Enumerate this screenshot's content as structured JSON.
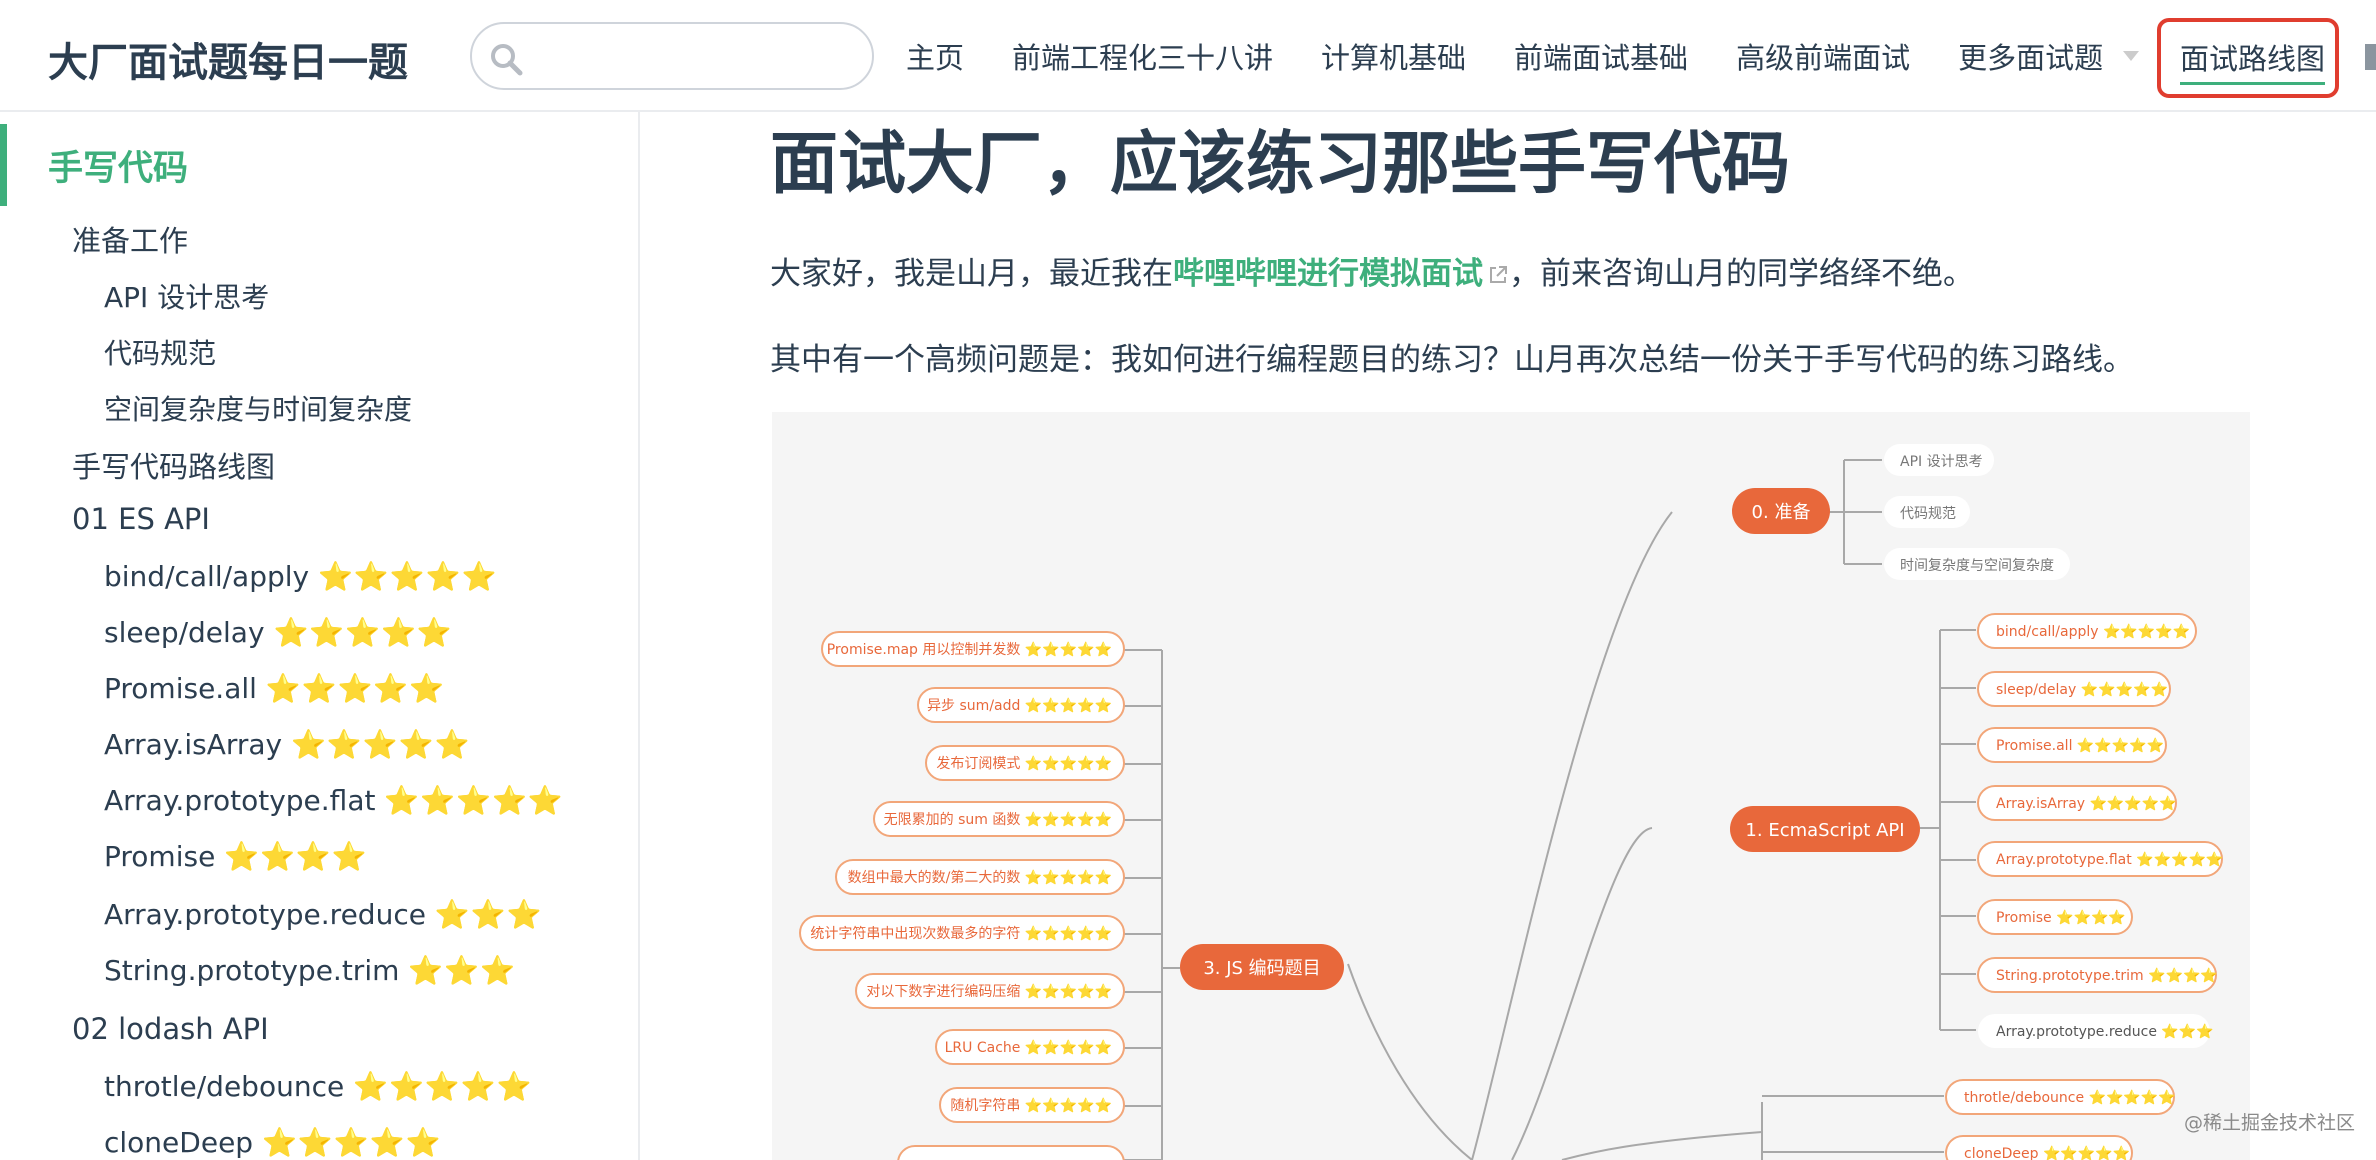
{
  "navbar": {
    "site_name": "大厂面试题每日一题",
    "search": {
      "placeholder": "",
      "value": ""
    },
    "links": [
      {
        "label": "主页"
      },
      {
        "label": "前端工程化三十八讲"
      },
      {
        "label": "计算机基础"
      },
      {
        "label": "前端面试基础"
      },
      {
        "label": "高级前端面试"
      },
      {
        "label": "更多面试题"
      }
    ],
    "active_link": "面试路线图",
    "accent_color": "#3eaf7c",
    "highlight_color": "#e03d2f"
  },
  "sidebar": {
    "heading": "手写代码",
    "items": [
      {
        "label": "准备工作",
        "stars": ""
      },
      {
        "label": "API 设计思考",
        "stars": ""
      },
      {
        "label": "代码规范",
        "stars": ""
      },
      {
        "label": "空间复杂度与时间复杂度",
        "stars": ""
      },
      {
        "label": "手写代码路线图",
        "stars": ""
      },
      {
        "label": "01 ES API",
        "stars": ""
      },
      {
        "label": "bind/call/apply",
        "stars": "⭐⭐⭐⭐⭐"
      },
      {
        "label": "sleep/delay",
        "stars": "⭐⭐⭐⭐⭐"
      },
      {
        "label": "Promise.all",
        "stars": "⭐⭐⭐⭐⭐"
      },
      {
        "label": "Array.isArray",
        "stars": "⭐⭐⭐⭐⭐"
      },
      {
        "label": "Array.prototype.flat",
        "stars": "⭐⭐⭐⭐⭐"
      },
      {
        "label": "Promise",
        "stars": "⭐⭐⭐⭐"
      },
      {
        "label": "Array.prototype.reduce",
        "stars": "⭐⭐⭐"
      },
      {
        "label": "String.prototype.trim",
        "stars": "⭐⭐⭐"
      },
      {
        "label": "02 lodash API",
        "stars": ""
      },
      {
        "label": "throtle/debounce",
        "stars": "⭐⭐⭐⭐⭐"
      },
      {
        "label": "cloneDeep",
        "stars": "⭐⭐⭐⭐⭐"
      }
    ]
  },
  "content": {
    "title": "面试大厂，应该练习那些手写代码",
    "para1_before": "大家好，我是山月，最近我在",
    "para1_link": "哔哩哔哩进行模拟面试",
    "para1_after": "，前来咨询山月的同学络绎不绝。",
    "para2": "其中有一个高频问题是：我如何进行编程题目的练习？山月再次总结一份关于手写代码的练习路线。",
    "watermark": "@稀土掘金技术社区"
  },
  "mindmap": {
    "hubs": {
      "prep": "0. 准备",
      "ecma": "1. EcmaScript API",
      "js": "3. JS 编码题目"
    },
    "prep_items": [
      "API 设计思考",
      "代码规范",
      "时间复杂度与空间复杂度"
    ],
    "ecma_items": [
      "bind/call/apply ⭐⭐⭐⭐⭐",
      "sleep/delay ⭐⭐⭐⭐⭐",
      "Promise.all ⭐⭐⭐⭐⭐",
      "Array.isArray ⭐⭐⭐⭐⭐",
      "Array.prototype.flat ⭐⭐⭐⭐⭐",
      "Promise ⭐⭐⭐⭐",
      "String.prototype.trim ⭐⭐⭐⭐",
      "Array.prototype.reduce ⭐⭐⭐"
    ],
    "lodash_items": [
      "throtle/debounce ⭐⭐⭐⭐⭐",
      "cloneDeep ⭐⭐⭐⭐⭐"
    ],
    "js_items": [
      "Promise.map 用以控制并发数 ⭐⭐⭐⭐⭐",
      "异步 sum/add ⭐⭐⭐⭐⭐",
      "发布订阅模式 ⭐⭐⭐⭐⭐",
      "无限累加的 sum 函数 ⭐⭐⭐⭐⭐",
      "数组中最大的数/第二大的数 ⭐⭐⭐⭐⭐",
      "统计字符串中出现次数最多的字符 ⭐⭐⭐⭐⭐",
      "对以下数字进行编码压缩 ⭐⭐⭐⭐⭐",
      "LRU Cache ⭐⭐⭐⭐⭐",
      "随机字符串 ⭐⭐⭐⭐⭐"
    ]
  }
}
